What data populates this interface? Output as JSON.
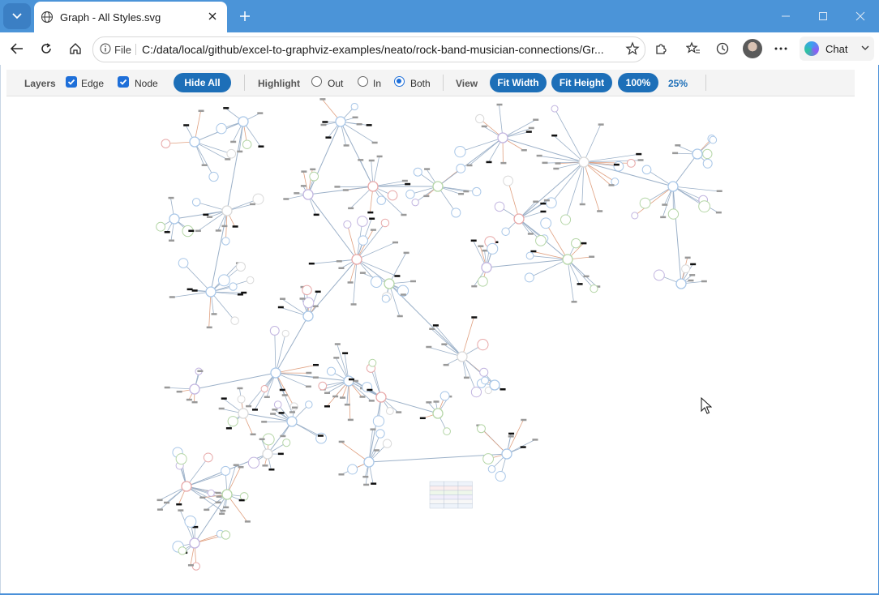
{
  "browser": {
    "tab_title": "Graph - All Styles.svg",
    "file_label": "File",
    "url": "C:/data/local/github/excel-to-graphviz-examples/neato/rock-band-musician-connections/Gr...",
    "chat_label": "Chat"
  },
  "toolbar": {
    "layers_label": "Layers",
    "edge_label": "Edge",
    "node_label": "Node",
    "hide_all_label": "Hide All",
    "highlight_label": "Highlight",
    "out_label": "Out",
    "in_label": "In",
    "both_label": "Both",
    "view_label": "View",
    "fit_width_label": "Fit Width",
    "fit_height_label": "Fit Height",
    "zoom_100_label": "100%",
    "zoom_25_label": "25%"
  },
  "state": {
    "edge_checked": true,
    "node_checked": true,
    "highlight_mode": "Both"
  },
  "icons": [
    "tab-list-icon",
    "globe-icon",
    "close-icon",
    "plus-icon",
    "minimize-icon",
    "maximize-icon",
    "window-close-icon",
    "back-icon",
    "refresh-icon",
    "home-icon",
    "info-icon",
    "star-icon",
    "extensions-icon",
    "favorites-icon",
    "history-icon",
    "more-icon",
    "cursor-icon"
  ],
  "colors": {
    "titlebar": "#4b94d8",
    "accent": "#1d6fb8",
    "node_blue": "#a9c7e8",
    "node_red": "#e8a9a9",
    "node_green": "#b5d6a7",
    "node_purple": "#c2b5e0",
    "edge": "#9bb0c8"
  }
}
